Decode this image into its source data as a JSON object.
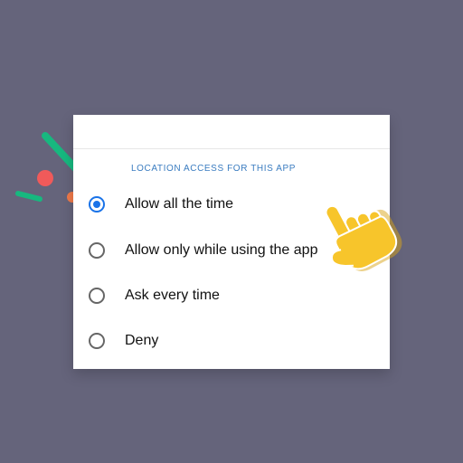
{
  "dialog": {
    "header": "LOCATION ACCESS FOR THIS APP",
    "options": [
      {
        "label": "Allow all the time",
        "selected": true
      },
      {
        "label": "Allow only while using the app",
        "selected": false
      },
      {
        "label": "Ask every time",
        "selected": false
      },
      {
        "label": "Deny",
        "selected": false
      }
    ]
  },
  "decorations": {
    "cursor": "pointing-hand-icon",
    "sparkle": "sparkle-icon"
  },
  "colors": {
    "background": "#65647b",
    "accent": "#1a73e8",
    "header_text": "#3a7cc0",
    "hand": "#f7c52b",
    "sparkle_green": "#17b87f",
    "sparkle_red": "#f05a5a",
    "sparkle_orange": "#f07a4a"
  }
}
